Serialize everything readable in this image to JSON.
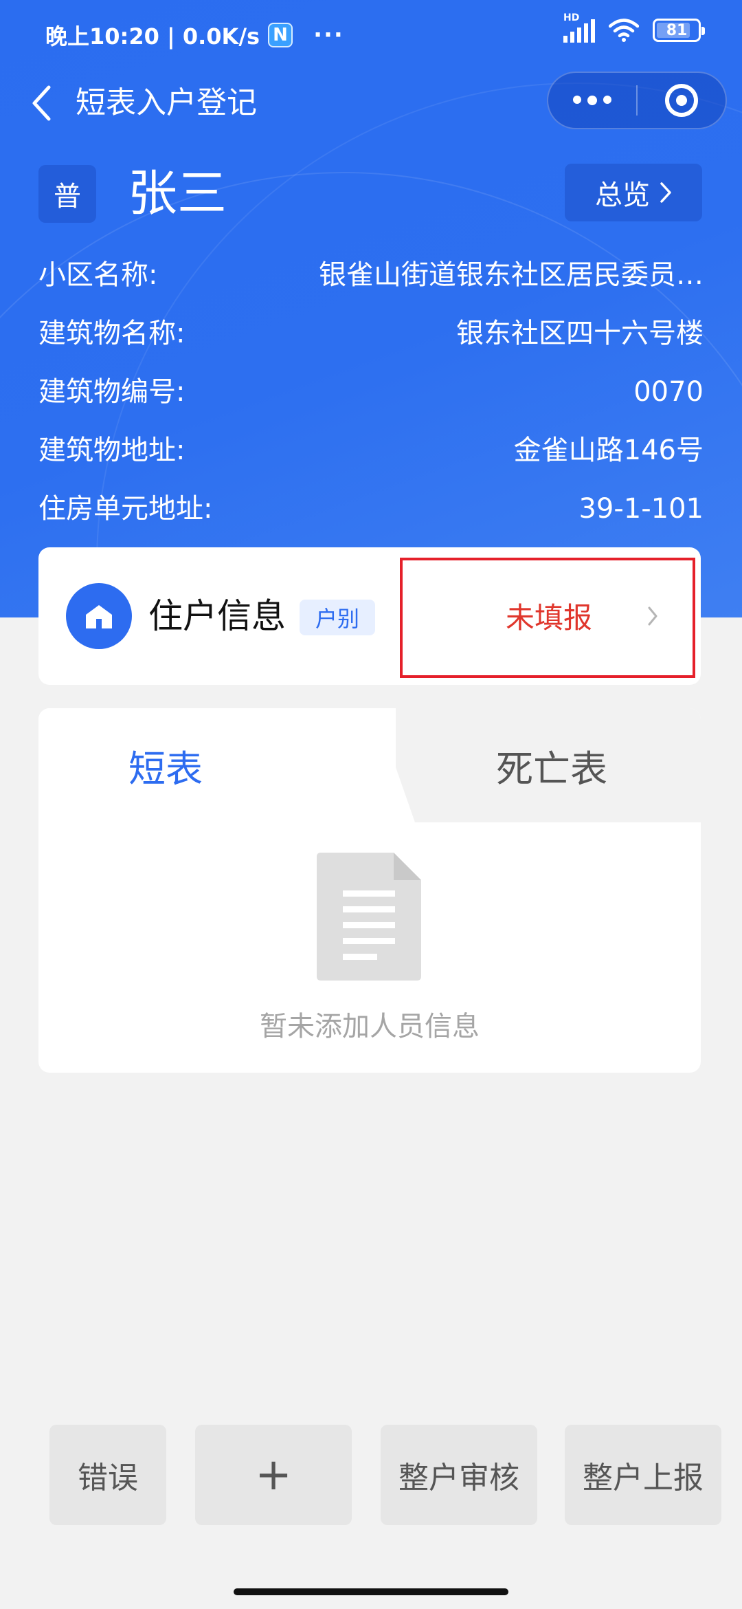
{
  "status_bar": {
    "time_speed": "晚上10:20 | 0.0K/s",
    "n_badge": "N",
    "dots": "···",
    "signal_tag": "HD",
    "battery": "81"
  },
  "nav": {
    "title": "短表入户登记"
  },
  "person": {
    "type_badge": "普",
    "name": "张三",
    "overview_label": "总览"
  },
  "info": [
    {
      "label": "小区名称:",
      "value": "银雀山街道银东社区居民委员…"
    },
    {
      "label": "建筑物名称:",
      "value": "银东社区四十六号楼"
    },
    {
      "label": "建筑物编号:",
      "value": "0070"
    },
    {
      "label": "建筑物地址:",
      "value": "金雀山路146号"
    },
    {
      "label": "住房单元地址:",
      "value": "39-1-101"
    }
  ],
  "household": {
    "label": "住户信息",
    "tag": "户别",
    "status": "未填报"
  },
  "tabs": [
    {
      "label": "短表"
    },
    {
      "label": "死亡表"
    }
  ],
  "empty_state": {
    "text": "暂未添加人员信息"
  },
  "actions": {
    "error": "错误",
    "add": "+",
    "audit": "整户审核",
    "report": "整户上报"
  },
  "colors": {
    "primary": "#2d6cf0",
    "status_red": "#e0362c",
    "highlight_border": "#e5202a"
  }
}
